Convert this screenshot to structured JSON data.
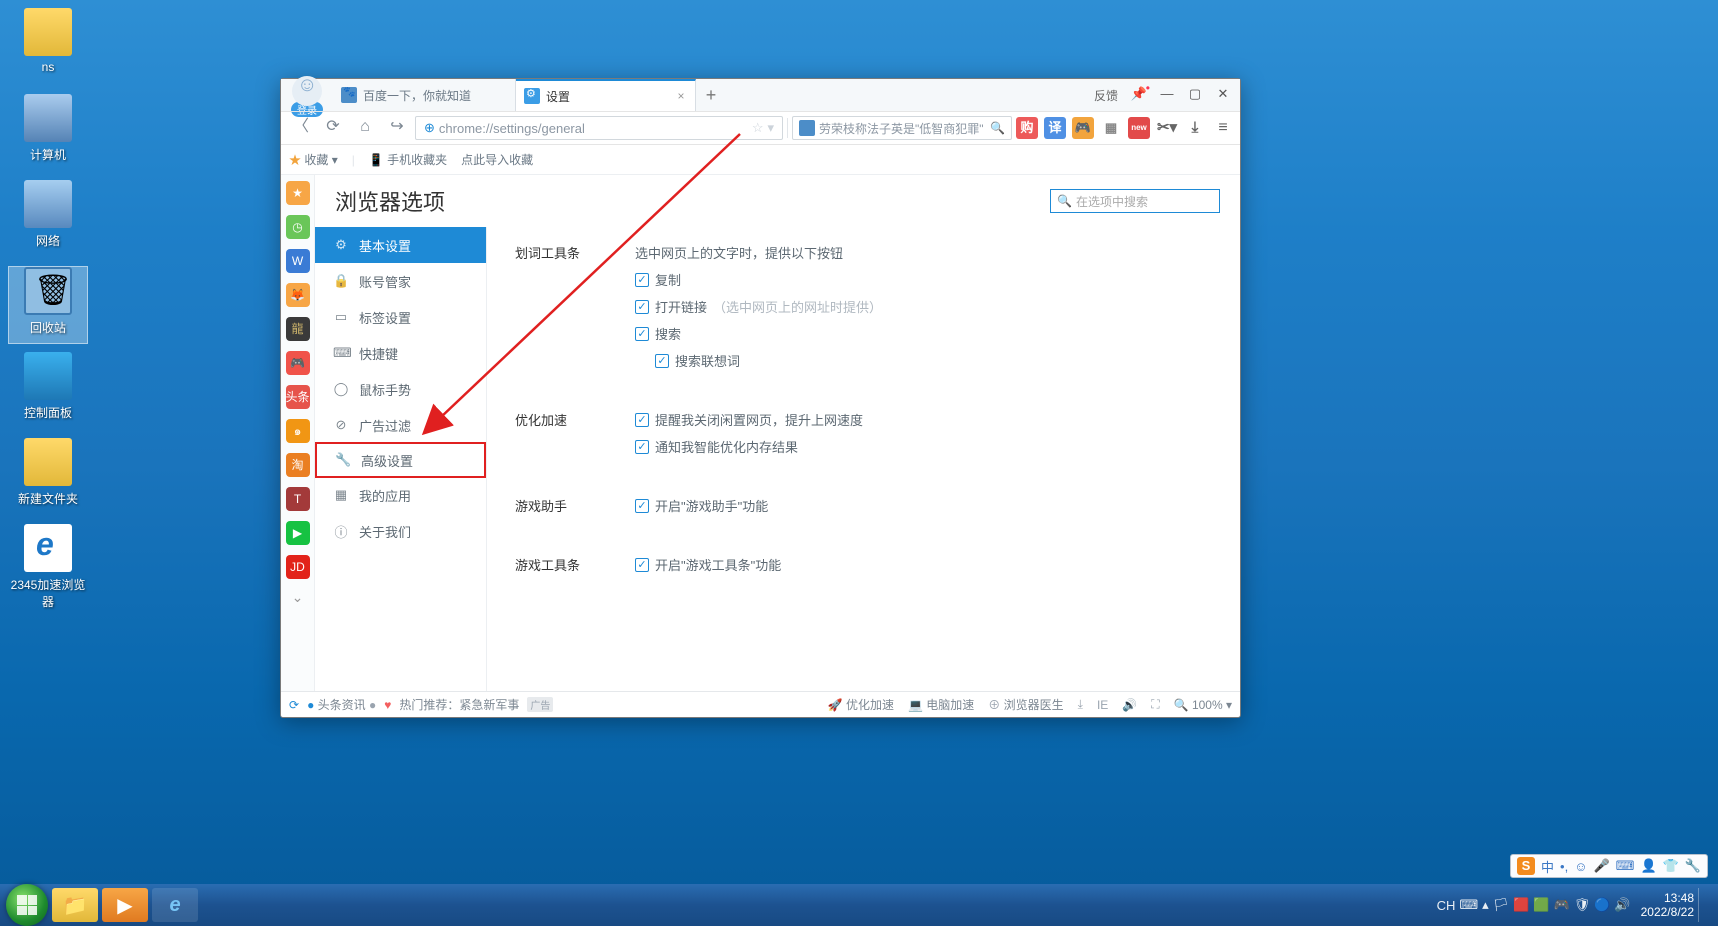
{
  "desktop": {
    "icons": [
      {
        "name": "ns",
        "icon": "folder"
      },
      {
        "name": "计算机",
        "icon": "comp"
      },
      {
        "name": "网络",
        "icon": "net"
      },
      {
        "name": "回收站",
        "icon": "bin",
        "selected": true
      },
      {
        "name": "控制面板",
        "icon": "panel"
      },
      {
        "name": "新建文件夹",
        "icon": "folder"
      },
      {
        "name": "2345加速浏览器",
        "icon": "ie"
      }
    ]
  },
  "browser": {
    "avatar_login": "登录",
    "tabs": [
      {
        "title": "百度一下，你就知道",
        "active": false,
        "icon": "bai"
      },
      {
        "title": "设置",
        "active": true,
        "icon": "setg"
      }
    ],
    "win": {
      "feedback": "反馈"
    },
    "addr": {
      "url": "chrome://settings/general"
    },
    "search": {
      "placeholder": "劳荣枝称法子英是\"低智商犯罪\""
    },
    "favbar": {
      "fav": "收藏",
      "mobile": "手机收藏夹",
      "import": "点此导入收藏"
    },
    "settings": {
      "title": "浏览器选项",
      "search_placeholder": "在选项中搜索",
      "nav": [
        {
          "label": "基本设置",
          "icon": "⚙",
          "active": true
        },
        {
          "label": "账号管家",
          "icon": "🔒"
        },
        {
          "label": "标签设置",
          "icon": "▭"
        },
        {
          "label": "快捷键",
          "icon": "⌨"
        },
        {
          "label": "鼠标手势",
          "icon": "◯"
        },
        {
          "label": "广告过滤",
          "icon": "⊘"
        },
        {
          "label": "高级设置",
          "icon": "🔧",
          "highlighted": true
        },
        {
          "label": "我的应用",
          "icon": "▦"
        },
        {
          "label": "关于我们",
          "icon": "ⓘ"
        }
      ],
      "sections": {
        "select_tool": {
          "label": "划词工具条",
          "hint": "选中网页上的文字时，提供以下按钮",
          "copy": "复制",
          "open_link": "打开链接",
          "open_link_hint": "（选中网页上的网址时提供）",
          "search": "搜索",
          "suggest": "搜索联想词"
        },
        "speed": {
          "label": "优化加速",
          "remind": "提醒我关闭闲置网页，提升上网速度",
          "notify": "通知我智能优化内存结果"
        },
        "game_helper": {
          "label": "游戏助手",
          "enable": "开启\"游戏助手\"功能"
        },
        "game_toolbar": {
          "label": "游戏工具条",
          "enable": "开启\"游戏工具条\"功能"
        }
      }
    },
    "statusbar": {
      "news": "头条资讯",
      "hot": "热门推荐：紧急新军事",
      "tag": "广告",
      "speedup": "优化加速",
      "pc_speedup": "电脑加速",
      "doctor": "浏览器医生",
      "zoom": "100%"
    }
  },
  "ime": {
    "cn": "中"
  },
  "tray": {
    "ime_label": "CH"
  },
  "clock": {
    "time": "13:48",
    "date": "2022/8/22"
  }
}
